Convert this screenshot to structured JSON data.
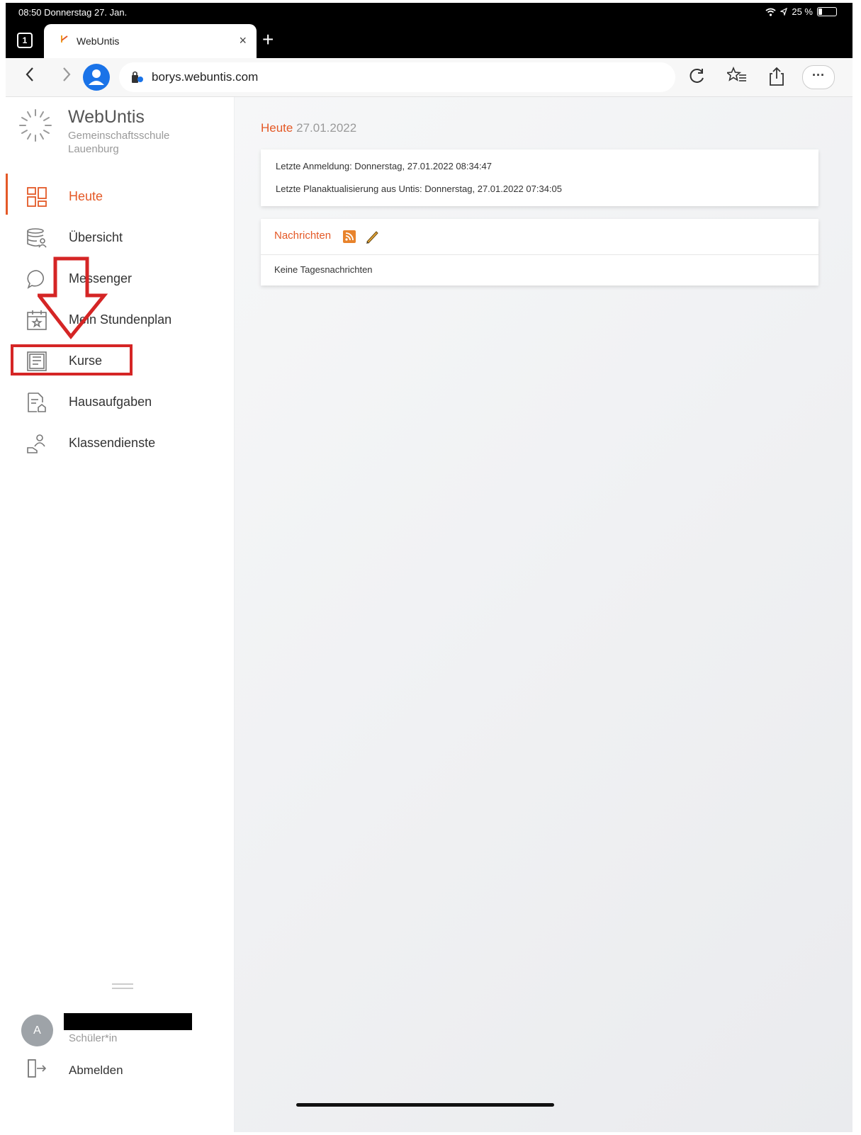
{
  "status_bar": {
    "time": "08:50  Donnerstag 27. Jan.",
    "battery": "25 %"
  },
  "browser": {
    "tab_count": "1",
    "tab_title": "WebUntis",
    "tab_close": "×",
    "new_tab": "+",
    "url": "borys.webuntis.com"
  },
  "sidebar": {
    "brand": "WebUntis",
    "school": "Gemeinschaftsschule Lauenburg",
    "items": [
      {
        "label": "Heute",
        "icon": "dashboard-icon",
        "active": true
      },
      {
        "label": "Übersicht",
        "icon": "overview-icon"
      },
      {
        "label": "Messenger",
        "icon": "chat-bubble-icon"
      },
      {
        "label": "Mein Stundenplan",
        "icon": "calendar-star-icon"
      },
      {
        "label": "Kurse",
        "icon": "courses-icon"
      },
      {
        "label": "Hausaufgaben",
        "icon": "homework-icon"
      },
      {
        "label": "Klassendienste",
        "icon": "class-duties-icon"
      }
    ],
    "user": {
      "avatar_initial": "A",
      "role": "Schüler*in"
    },
    "logout": "Abmelden"
  },
  "main": {
    "title_word": "Heute",
    "title_date": "27.01.2022",
    "last_login": "Letzte Anmeldung: Donnerstag, 27.01.2022 08:34:47",
    "last_update": "Letzte Planaktualisierung aus Untis: Donnerstag, 27.01.2022 07:34:05",
    "news_title": "Nachrichten",
    "news_empty": "Keine Tagesnachrichten"
  },
  "colors": {
    "accent": "#e45927",
    "annotation": "#d52525"
  }
}
